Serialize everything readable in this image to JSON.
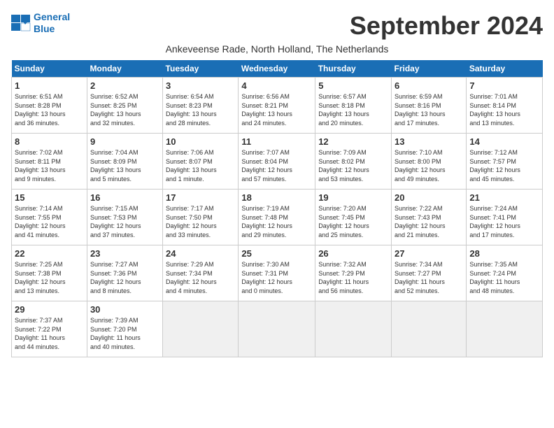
{
  "app": {
    "name_line1": "General",
    "name_line2": "Blue"
  },
  "calendar": {
    "month_year": "September 2024",
    "subtitle": "Ankeveense Rade, North Holland, The Netherlands",
    "headers": [
      "Sunday",
      "Monday",
      "Tuesday",
      "Wednesday",
      "Thursday",
      "Friday",
      "Saturday"
    ],
    "weeks": [
      [
        {
          "day": "1",
          "detail": "Sunrise: 6:51 AM\nSunset: 8:28 PM\nDaylight: 13 hours\nand 36 minutes."
        },
        {
          "day": "2",
          "detail": "Sunrise: 6:52 AM\nSunset: 8:25 PM\nDaylight: 13 hours\nand 32 minutes."
        },
        {
          "day": "3",
          "detail": "Sunrise: 6:54 AM\nSunset: 8:23 PM\nDaylight: 13 hours\nand 28 minutes."
        },
        {
          "day": "4",
          "detail": "Sunrise: 6:56 AM\nSunset: 8:21 PM\nDaylight: 13 hours\nand 24 minutes."
        },
        {
          "day": "5",
          "detail": "Sunrise: 6:57 AM\nSunset: 8:18 PM\nDaylight: 13 hours\nand 20 minutes."
        },
        {
          "day": "6",
          "detail": "Sunrise: 6:59 AM\nSunset: 8:16 PM\nDaylight: 13 hours\nand 17 minutes."
        },
        {
          "day": "7",
          "detail": "Sunrise: 7:01 AM\nSunset: 8:14 PM\nDaylight: 13 hours\nand 13 minutes."
        }
      ],
      [
        {
          "day": "8",
          "detail": "Sunrise: 7:02 AM\nSunset: 8:11 PM\nDaylight: 13 hours\nand 9 minutes."
        },
        {
          "day": "9",
          "detail": "Sunrise: 7:04 AM\nSunset: 8:09 PM\nDaylight: 13 hours\nand 5 minutes."
        },
        {
          "day": "10",
          "detail": "Sunrise: 7:06 AM\nSunset: 8:07 PM\nDaylight: 13 hours\nand 1 minute."
        },
        {
          "day": "11",
          "detail": "Sunrise: 7:07 AM\nSunset: 8:04 PM\nDaylight: 12 hours\nand 57 minutes."
        },
        {
          "day": "12",
          "detail": "Sunrise: 7:09 AM\nSunset: 8:02 PM\nDaylight: 12 hours\nand 53 minutes."
        },
        {
          "day": "13",
          "detail": "Sunrise: 7:10 AM\nSunset: 8:00 PM\nDaylight: 12 hours\nand 49 minutes."
        },
        {
          "day": "14",
          "detail": "Sunrise: 7:12 AM\nSunset: 7:57 PM\nDaylight: 12 hours\nand 45 minutes."
        }
      ],
      [
        {
          "day": "15",
          "detail": "Sunrise: 7:14 AM\nSunset: 7:55 PM\nDaylight: 12 hours\nand 41 minutes."
        },
        {
          "day": "16",
          "detail": "Sunrise: 7:15 AM\nSunset: 7:53 PM\nDaylight: 12 hours\nand 37 minutes."
        },
        {
          "day": "17",
          "detail": "Sunrise: 7:17 AM\nSunset: 7:50 PM\nDaylight: 12 hours\nand 33 minutes."
        },
        {
          "day": "18",
          "detail": "Sunrise: 7:19 AM\nSunset: 7:48 PM\nDaylight: 12 hours\nand 29 minutes."
        },
        {
          "day": "19",
          "detail": "Sunrise: 7:20 AM\nSunset: 7:45 PM\nDaylight: 12 hours\nand 25 minutes."
        },
        {
          "day": "20",
          "detail": "Sunrise: 7:22 AM\nSunset: 7:43 PM\nDaylight: 12 hours\nand 21 minutes."
        },
        {
          "day": "21",
          "detail": "Sunrise: 7:24 AM\nSunset: 7:41 PM\nDaylight: 12 hours\nand 17 minutes."
        }
      ],
      [
        {
          "day": "22",
          "detail": "Sunrise: 7:25 AM\nSunset: 7:38 PM\nDaylight: 12 hours\nand 13 minutes."
        },
        {
          "day": "23",
          "detail": "Sunrise: 7:27 AM\nSunset: 7:36 PM\nDaylight: 12 hours\nand 8 minutes."
        },
        {
          "day": "24",
          "detail": "Sunrise: 7:29 AM\nSunset: 7:34 PM\nDaylight: 12 hours\nand 4 minutes."
        },
        {
          "day": "25",
          "detail": "Sunrise: 7:30 AM\nSunset: 7:31 PM\nDaylight: 12 hours\nand 0 minutes."
        },
        {
          "day": "26",
          "detail": "Sunrise: 7:32 AM\nSunset: 7:29 PM\nDaylight: 11 hours\nand 56 minutes."
        },
        {
          "day": "27",
          "detail": "Sunrise: 7:34 AM\nSunset: 7:27 PM\nDaylight: 11 hours\nand 52 minutes."
        },
        {
          "day": "28",
          "detail": "Sunrise: 7:35 AM\nSunset: 7:24 PM\nDaylight: 11 hours\nand 48 minutes."
        }
      ],
      [
        {
          "day": "29",
          "detail": "Sunrise: 7:37 AM\nSunset: 7:22 PM\nDaylight: 11 hours\nand 44 minutes."
        },
        {
          "day": "30",
          "detail": "Sunrise: 7:39 AM\nSunset: 7:20 PM\nDaylight: 11 hours\nand 40 minutes."
        },
        null,
        null,
        null,
        null,
        null
      ]
    ]
  }
}
